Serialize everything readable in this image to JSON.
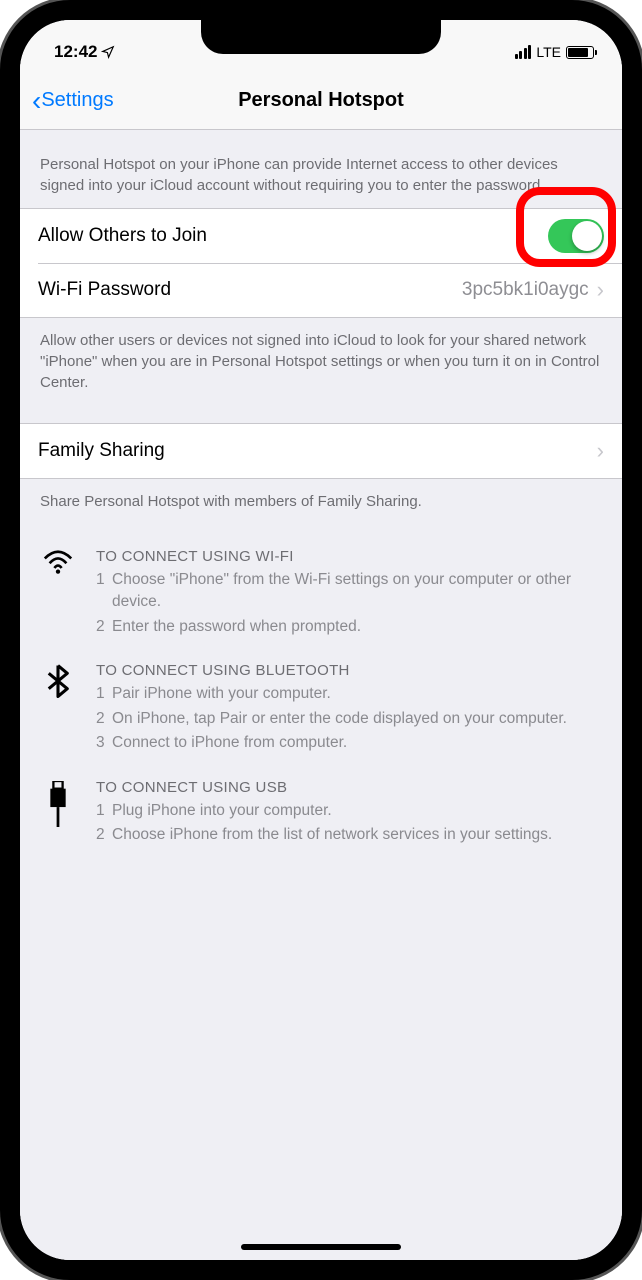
{
  "status": {
    "time": "12:42",
    "network": "LTE"
  },
  "nav": {
    "back": "Settings",
    "title": "Personal Hotspot"
  },
  "header1": "Personal Hotspot on your iPhone can provide Internet access to other devices signed into your iCloud account without requiring you to enter the password.",
  "rows": {
    "allow": "Allow Others to Join",
    "wifipw_label": "Wi-Fi Password",
    "wifipw_value": "3pc5bk1i0aygc"
  },
  "footer1": "Allow other users or devices not signed into iCloud to look for your shared network \"iPhone\" when you are in Personal Hotspot settings or when you turn it on in Control Center.",
  "family": {
    "label": "Family Sharing"
  },
  "footer2": "Share Personal Hotspot with members of Family Sharing.",
  "instructions": {
    "wifi": {
      "title": "TO CONNECT USING WI-FI",
      "s1": "Choose \"iPhone\" from the Wi-Fi settings on your computer or other device.",
      "s2": "Enter the password when prompted."
    },
    "bt": {
      "title": "TO CONNECT USING BLUETOOTH",
      "s1": "Pair iPhone with your computer.",
      "s2": "On iPhone, tap Pair or enter the code displayed on your computer.",
      "s3": "Connect to iPhone from computer."
    },
    "usb": {
      "title": "TO CONNECT USING USB",
      "s1": "Plug iPhone into your computer.",
      "s2": "Choose iPhone from the list of network services in your settings."
    }
  }
}
